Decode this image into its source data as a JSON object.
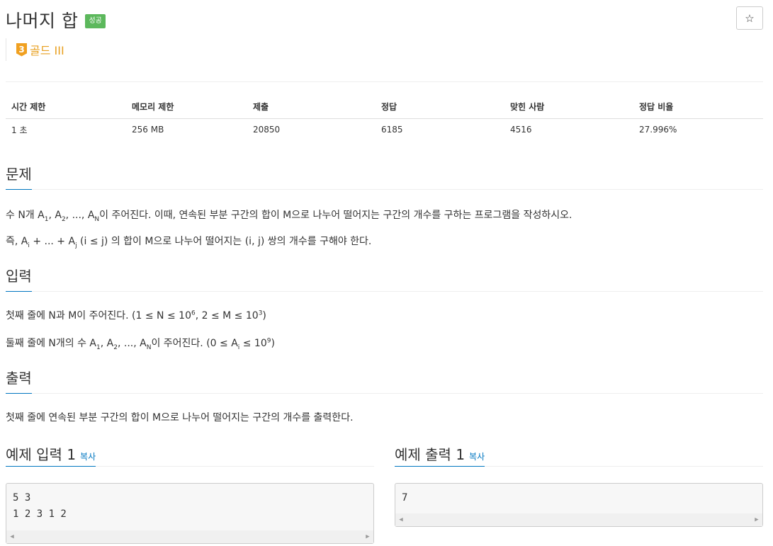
{
  "problem": {
    "title": "나머지 합",
    "badge": "성공",
    "tier_number": "3",
    "tier_label": "골드 III"
  },
  "icons": {
    "star": "star-icon",
    "tier": "tier-shield-icon"
  },
  "colors": {
    "success": "#5cb85c",
    "gold": "#e8a020",
    "link": "#0076c0"
  },
  "info_table": {
    "headers": [
      "시간 제한",
      "메모리 제한",
      "제출",
      "정답",
      "맞힌 사람",
      "정답 비율"
    ],
    "values": [
      "1 초",
      "256 MB",
      "20850",
      "6185",
      "4516",
      "27.996%"
    ]
  },
  "sections": {
    "problem_title": "문제",
    "input_title": "입력",
    "output_title": "출력"
  },
  "text": {
    "p1_a": "수 N개 A",
    "p1_sub1": "1",
    "p1_b": ", A",
    "p1_sub2": "2",
    "p1_c": ", ..., A",
    "p1_subN": "N",
    "p1_d": "이 주어진다. 이때, 연속된 부분 구간의 합이 M으로 나누어 떨어지는 구간의 개수를 구하는 프로그램을 작성하시오.",
    "p2_a": "즉, A",
    "p2_subi": "i",
    "p2_b": " + ... + A",
    "p2_subj": "j",
    "p2_c": " (i ≤ j) 의 합이 M으로 나누어 떨어지는 (i, j) 쌍의 개수를 구해야 한다.",
    "in1_a": "첫째 줄에 N과 M이 주어진다. (1 ≤ N ≤ 10",
    "in1_sup1": "6",
    "in1_b": ", 2 ≤ M ≤ 10",
    "in1_sup2": "3",
    "in1_c": ")",
    "in2_a": "둘째 줄에 N개의 수 A",
    "in2_sub1": "1",
    "in2_b": ", A",
    "in2_sub2": "2",
    "in2_c": ", ..., A",
    "in2_subN": "N",
    "in2_d": "이 주어진다. (0 ≤ A",
    "in2_subi": "i",
    "in2_e": " ≤ 10",
    "in2_sup": "9",
    "in2_f": ")",
    "out1": "첫째 줄에 연속된 부분 구간의 합이 M으로 나누어 떨어지는 구간의 개수를 출력한다."
  },
  "samples": {
    "input_title": "예제 입력 1",
    "output_title": "예제 출력 1",
    "copy_label": "복사",
    "input_line1": "5 3",
    "input_line2": "1 2 3 1 2",
    "output_line1": "7"
  }
}
